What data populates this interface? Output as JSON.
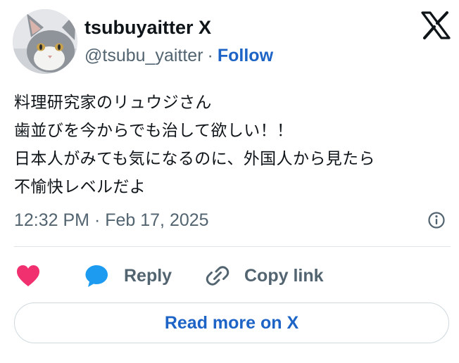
{
  "author": {
    "display_name": "tsubuyaitter X",
    "handle": "@tsubu_yaitter",
    "separator": "·",
    "follow_label": "Follow"
  },
  "tweet": {
    "lines": [
      "料理研究家のリュウジさん",
      "歯並びを今からでも治して欲しい！！",
      "日本人がみても気になるのに、外国人から見たら",
      "不愉快レベルだよ"
    ],
    "timestamp": "12:32 PM · Feb 17, 2025"
  },
  "actions": {
    "reply_label": "Reply",
    "copy_link_label": "Copy link"
  },
  "read_more_label": "Read more on X",
  "icons": {
    "brand": "x-logo-icon",
    "info": "info-icon",
    "like": "heart-icon",
    "reply": "speech-bubble-icon",
    "copy": "link-icon"
  },
  "colors": {
    "text_primary": "#0f1419",
    "text_secondary": "#536471",
    "link_blue": "#1d64c6",
    "heart_pink": "#f1306f",
    "reply_blue": "#1d9bf0",
    "border": "#cfd9de"
  }
}
